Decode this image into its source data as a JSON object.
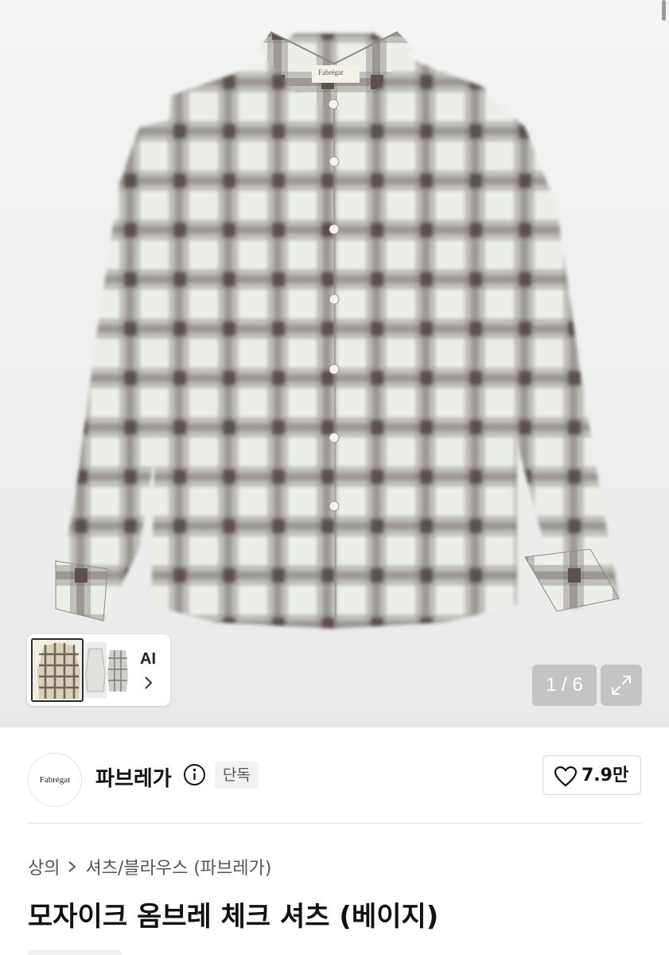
{
  "gallery": {
    "logo_label_text": "Fabrégat",
    "ai_label": "AI",
    "page_counter": "1 / 6",
    "expand_icon": "expand-icon",
    "colors": {
      "check_dark": "#5f5552",
      "check_light": "#ebeee6",
      "check_mid": "#a49d98"
    }
  },
  "brand": {
    "logo_text": "Fabrégat",
    "name": "파브레가",
    "info_icon": "info-icon",
    "badge": "단독",
    "like_icon": "heart-icon",
    "like_count": "7.9만"
  },
  "breadcrumb": {
    "level1": "상의",
    "level2": "셔츠/블라우스 (파브레가)",
    "separator_icon": "chevron-right-icon"
  },
  "product": {
    "title": "모자이크 옴브레 체크 셔츠 (베이지)"
  }
}
